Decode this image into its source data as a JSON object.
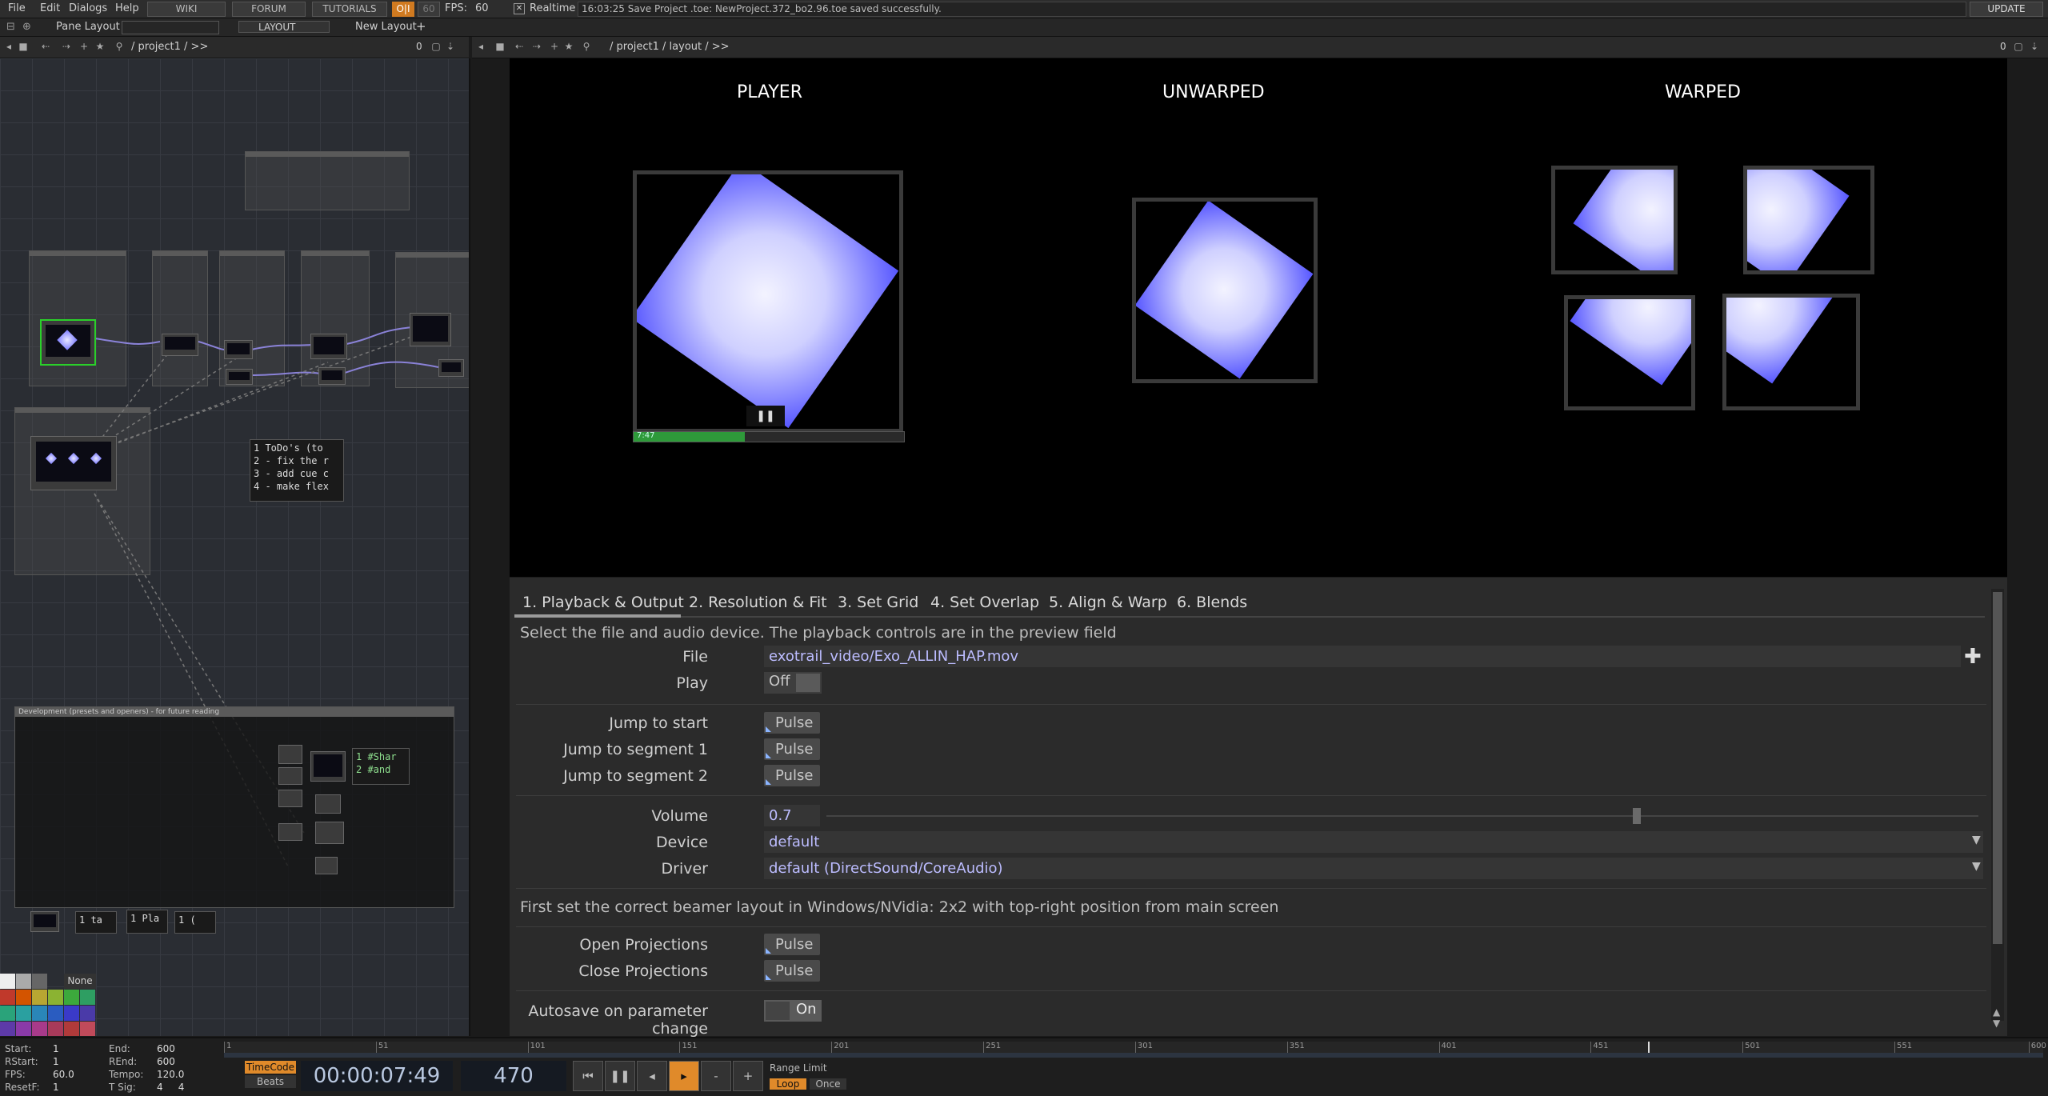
{
  "menubar": {
    "items": [
      "File",
      "Edit",
      "Dialogs",
      "Help"
    ],
    "links": [
      "WIKI",
      "FORUM",
      "TUTORIALS"
    ],
    "fps_value_a": "60",
    "fps_label": "FPS:",
    "fps_value": "60",
    "realtime_label": "Realtime",
    "status_message": "16:03:25 Save Project .toe: NewProject.372_bo2.96.toe saved successfully.",
    "update_label": "UPDATE"
  },
  "toolbar": {
    "pane_layout": "Pane Layout",
    "layout_label": "LAYOUT",
    "new_layout": "New Layout"
  },
  "left_path": {
    "path": "/ project1 / >>",
    "count": "0"
  },
  "right_path": {
    "path": "/ project1 / layout / >>",
    "count": "0"
  },
  "network": {
    "todo_lines": "1 ToDo's (to\n2 - fix the r\n3 - add cue c\n4 - make flex",
    "share_lines": "1 #Shar\n2 #and",
    "small_texts": [
      "1 ta",
      "1 Pla",
      "1 ("
    ],
    "dev_box_title": "Development (presets and openers) - for future reading",
    "color_none": "None"
  },
  "viewer": {
    "labels": {
      "player": "PLAYER",
      "unwarped": "UNWARPED",
      "warped": "WARPED"
    },
    "progress_time": "7:47",
    "progress_fraction": 0.41
  },
  "params": {
    "tabs": [
      "1. Playback & Output",
      "2. Resolution & Fit",
      "3. Set Grid",
      "4. Set Overlap",
      "5. Align & Warp",
      "6. Blends"
    ],
    "description": "Select the file and audio device. The playback controls are in the preview field",
    "file_label": "File",
    "file_value": "exotrail_video/Exo_ALLIN_HAP.mov",
    "play_label": "Play",
    "play_value": "Off",
    "jump_start_label": "Jump to start",
    "jump_seg1_label": "Jump to segment 1",
    "jump_seg2_label": "Jump to segment 2",
    "pulse_label": "Pulse",
    "volume_label": "Volume",
    "volume_value": "0.7",
    "device_label": "Device",
    "device_value": "default",
    "driver_label": "Driver",
    "driver_value": "default (DirectSound/CoreAudio)",
    "beamer_note": "First set the correct beamer layout in Windows/NVidia: 2x2 with top-right position from main screen",
    "open_proj_label": "Open Projections",
    "close_proj_label": "Close Projections",
    "autosave_label": "Autosave on parameter change",
    "autosave_value": "On"
  },
  "timeline": {
    "start_label": "Start:",
    "start": "1",
    "end_label": "End:",
    "end": "600",
    "rstart_label": "RStart:",
    "rstart": "1",
    "rend_label": "REnd:",
    "rend": "600",
    "fps_label": "FPS:",
    "fps": "60.0",
    "tempo_label": "Tempo:",
    "tempo": "120.0",
    "resetf_label": "ResetF:",
    "resetf": "1",
    "tsig_label": "T Sig:",
    "tsig": "4     4",
    "timecode_label": "TimeCode",
    "beats_label": "Beats",
    "timecode": "00:00:07:49",
    "frame": "470",
    "range_limit": "Range Limit",
    "loop": "Loop",
    "once": "Once",
    "ruler_ticks": [
      "1",
      "51",
      "101",
      "151",
      "201",
      "251",
      "301",
      "351",
      "401",
      "451",
      "501",
      "551",
      "600"
    ],
    "playhead_frame": 470
  },
  "colors": {
    "accent_orange": "#e08a2a",
    "tab_underline": "#9a9a9a",
    "link_text": "#bcbcff"
  }
}
